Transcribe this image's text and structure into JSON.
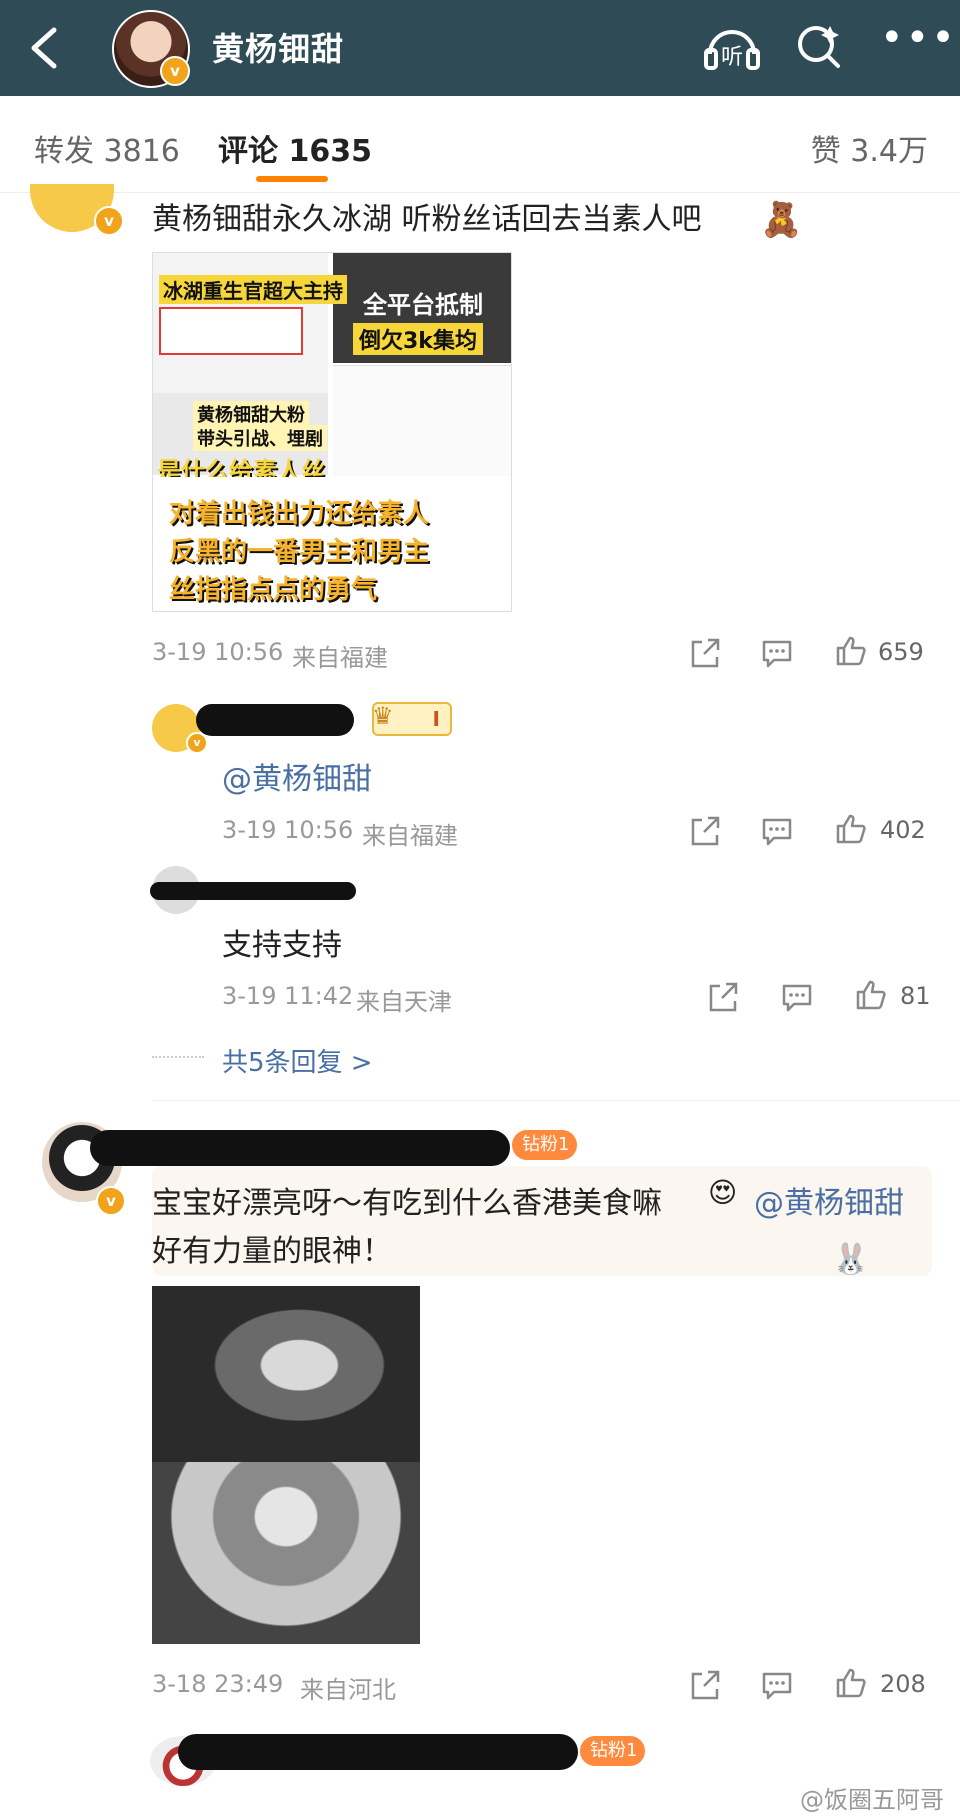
{
  "header": {
    "title": "黄杨钿甜",
    "listen_label": "听"
  },
  "tabs": {
    "repost": "转发 3816",
    "comment": "评论 1635",
    "like": "赞 3.4万"
  },
  "comment1": {
    "text": "黄杨钿甜永久冰湖 听粉丝话回去当素人吧",
    "image_text": {
      "t1": "冰湖重生官超大主持",
      "t2": "全平台抵制",
      "t3": "倒欠3k集均",
      "t4": "黄杨钿甜大粉",
      "t5": "带头引战、埋剧",
      "t6": "是什么给素人丝",
      "t7": "对着出钱出力还给素人",
      "t8": "反黑的一番男主和男主",
      "t9": "丝指指点点的勇气"
    },
    "time": "3-19 10:56",
    "location": "来自福建",
    "likes": "659",
    "reply1": {
      "badge": "I",
      "text": "@黄杨钿甜",
      "time": "3-19 10:56",
      "location": "来自福建",
      "likes": "402"
    },
    "reply2": {
      "text": "支持支持",
      "time": "3-19 11:42",
      "location": "来自天津",
      "likes": "81"
    },
    "more_replies": "共5条回复 >"
  },
  "comment2": {
    "badge": "钻粉1",
    "text_line1": "宝宝好漂亮呀～有吃到什么香港美食嘛",
    "mention": "@黄杨钿甜",
    "text_line2": "好有力量的眼神！",
    "time": "3-18 23:49",
    "location": "来自河北",
    "likes": "208"
  },
  "comment3": {
    "badge": "钻粉1"
  },
  "watermark": "@饭圈五阿哥",
  "colors": {
    "header_bg": "#2f4b55",
    "accent": "#ff8200",
    "mention": "#4a6fa5",
    "vip": "#f0a31b"
  }
}
